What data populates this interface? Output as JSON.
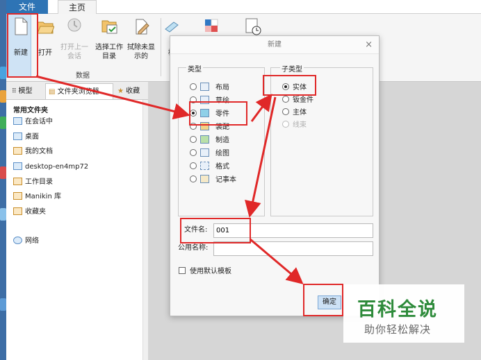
{
  "menu": {
    "file": "文件",
    "home": "主页"
  },
  "ribbon": {
    "buttons": [
      {
        "label": "新建",
        "icon": "new-file-icon"
      },
      {
        "label": "打开",
        "icon": "open-folder-icon"
      },
      {
        "label": "打开上一\n会话",
        "icon": "open-session-icon"
      },
      {
        "label": "选择工作\n目录",
        "icon": "select-dir-icon"
      },
      {
        "label": "拭除未显\n示的",
        "icon": "erase-icon"
      },
      {
        "label": "模",
        "icon": "model-icon"
      }
    ],
    "group_label": "数据"
  },
  "left_panel": {
    "tabs": [
      "模型",
      "文件夹浏览器",
      "收藏"
    ],
    "heading": "常用文件夹",
    "items": [
      {
        "label": "在会话中"
      },
      {
        "label": "桌面"
      },
      {
        "label": "我的文档"
      },
      {
        "label": "desktop-en4mp72"
      },
      {
        "label": "工作目录"
      },
      {
        "label": "Manikin 库"
      },
      {
        "label": "收藏夹"
      },
      {
        "label": "网络"
      }
    ]
  },
  "dialog": {
    "title": "新建",
    "close": "×",
    "type_legend": "类型",
    "types": [
      {
        "label": "布局",
        "selected": false
      },
      {
        "label": "草绘",
        "selected": false
      },
      {
        "label": "零件",
        "selected": true
      },
      {
        "label": "装配",
        "selected": false
      },
      {
        "label": "制造",
        "selected": false
      },
      {
        "label": "绘图",
        "selected": false
      },
      {
        "label": "格式",
        "selected": false
      },
      {
        "label": "记事本",
        "selected": false
      }
    ],
    "subtype_legend": "子类型",
    "subtypes": [
      {
        "label": "实体",
        "selected": true,
        "disabled": false
      },
      {
        "label": "钣金件",
        "selected": false,
        "disabled": false
      },
      {
        "label": "主体",
        "selected": false,
        "disabled": false
      },
      {
        "label": "线束",
        "selected": false,
        "disabled": true
      }
    ],
    "filename_label": "文件名:",
    "filename_value": "001",
    "common_name_label": "公用名称:",
    "common_name_value": "",
    "use_default_template": "使用默认模板",
    "ok_label": "确定"
  },
  "watermark": {
    "title": "百科全说",
    "subtitle": "助你轻松解决"
  },
  "colors": {
    "accent": "#2e74b5",
    "annotation": "#e02828",
    "watermark_green": "#2e8b3b"
  }
}
